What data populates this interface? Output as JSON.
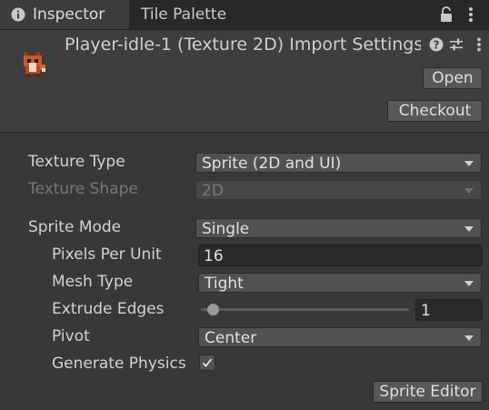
{
  "tabs": [
    {
      "label": "Inspector",
      "icon": "info-icon",
      "active": true
    },
    {
      "label": "Tile Palette",
      "active": false
    }
  ],
  "header": {
    "title": "Player-idle-1 (Texture 2D) Import Settings",
    "open_label": "Open",
    "checkout_label": "Checkout"
  },
  "fields": {
    "texture_type": {
      "label": "Texture Type",
      "value": "Sprite (2D and UI)"
    },
    "texture_shape": {
      "label": "Texture Shape",
      "value": "2D",
      "disabled": true
    },
    "sprite_mode": {
      "label": "Sprite Mode",
      "value": "Single"
    },
    "pixels_per_unit": {
      "label": "Pixels Per Unit",
      "value": "16"
    },
    "mesh_type": {
      "label": "Mesh Type",
      "value": "Tight"
    },
    "extrude_edges": {
      "label": "Extrude Edges",
      "value": "1",
      "slider_min": 0,
      "slider_max": 32
    },
    "pivot": {
      "label": "Pivot",
      "value": "Center"
    },
    "generate_physics": {
      "label": "Generate Physics",
      "checked": true
    }
  },
  "sprite_editor_label": "Sprite Editor",
  "colors": {
    "panel": "#383838",
    "tabbar": "#282828",
    "header": "#3e3e3e",
    "dropdown": "#515151",
    "textfield": "#2a2a2a",
    "text": "#d2d2d2",
    "disabled_text": "#777777"
  }
}
